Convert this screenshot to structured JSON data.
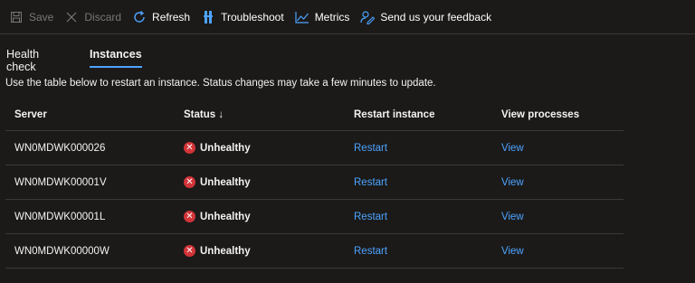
{
  "toolbar": {
    "save_label": "Save",
    "discard_label": "Discard",
    "refresh_label": "Refresh",
    "troubleshoot_label": "Troubleshoot",
    "metrics_label": "Metrics",
    "feedback_label": "Send us your feedback"
  },
  "tabs": [
    {
      "label": "Health check",
      "selected": false
    },
    {
      "label": "Instances",
      "selected": true
    }
  ],
  "description": "Use the table below to restart an instance. Status changes may take a few minutes to update.",
  "table": {
    "headers": {
      "server": "Server",
      "status": "Status ↓",
      "restart": "Restart instance",
      "processes": "View processes"
    },
    "rows": [
      {
        "server": "WN0MDWK000026",
        "status": "Unhealthy",
        "restart": "Restart",
        "processes": "View"
      },
      {
        "server": "WN0MDWK00001V",
        "status": "Unhealthy",
        "restart": "Restart",
        "processes": "View"
      },
      {
        "server": "WN0MDWK00001L",
        "status": "Unhealthy",
        "restart": "Restart",
        "processes": "View"
      },
      {
        "server": "WN0MDWK00000W",
        "status": "Unhealthy",
        "restart": "Restart",
        "processes": "View"
      }
    ]
  },
  "colors": {
    "background": "#1b1a19",
    "accent": "#4da3ff",
    "error": "#d13438",
    "disabled": "#797775"
  },
  "icons": [
    "save-icon",
    "discard-icon",
    "refresh-icon",
    "troubleshoot-icon",
    "metrics-icon",
    "feedback-icon",
    "error-icon"
  ]
}
